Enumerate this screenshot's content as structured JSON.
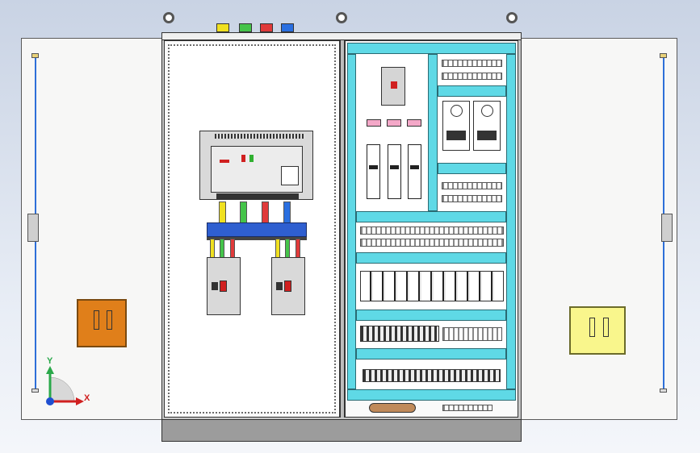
{
  "scene": {
    "kind": "electrical-cabinet-cad-view",
    "colors": {
      "background_top": "#c9d3e4",
      "accent_cyan": "#5fd9e6",
      "phase_yellow": "#f0e020",
      "phase_green": "#45c44a",
      "phase_red": "#e03a3a",
      "phase_blue": "#2a6fe0",
      "bus_support": "#2f5fd0",
      "lock_left": "#e07f1a",
      "lock_right": "#f9f68c"
    },
    "top_terminals": [
      "yellow",
      "green",
      "red",
      "blue"
    ]
  },
  "triad": {
    "x_label": "X",
    "y_label": "Y"
  },
  "icons": {
    "lifting_eye": "lifting-eye-icon",
    "door_lock": "door-lock-icon",
    "axis_triad": "axis-triad-icon"
  }
}
